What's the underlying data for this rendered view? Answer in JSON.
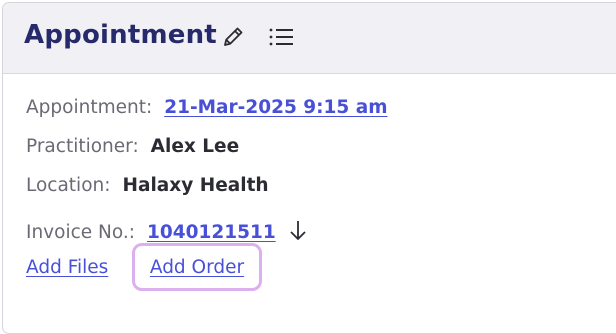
{
  "header": {
    "title": "Appointment",
    "edit_icon": "pencil-icon",
    "list_icon": "list-icon"
  },
  "details": {
    "appointment_label": "Appointment:",
    "appointment_value": "21-Mar-2025 9:15 am",
    "practitioner_label": "Practitioner:",
    "practitioner_value": "Alex Lee",
    "location_label": "Location:",
    "location_value": "Halaxy Health",
    "invoice_label": "Invoice No.:",
    "invoice_value": "1040121511",
    "download_icon": "download-arrow-icon"
  },
  "actions": {
    "add_files": "Add Files",
    "add_order": "Add Order"
  },
  "colors": {
    "title": "#262a6b",
    "link": "#4950d8",
    "header_bg": "#f1f1f5",
    "focus_ring": "#dcb0ee"
  }
}
